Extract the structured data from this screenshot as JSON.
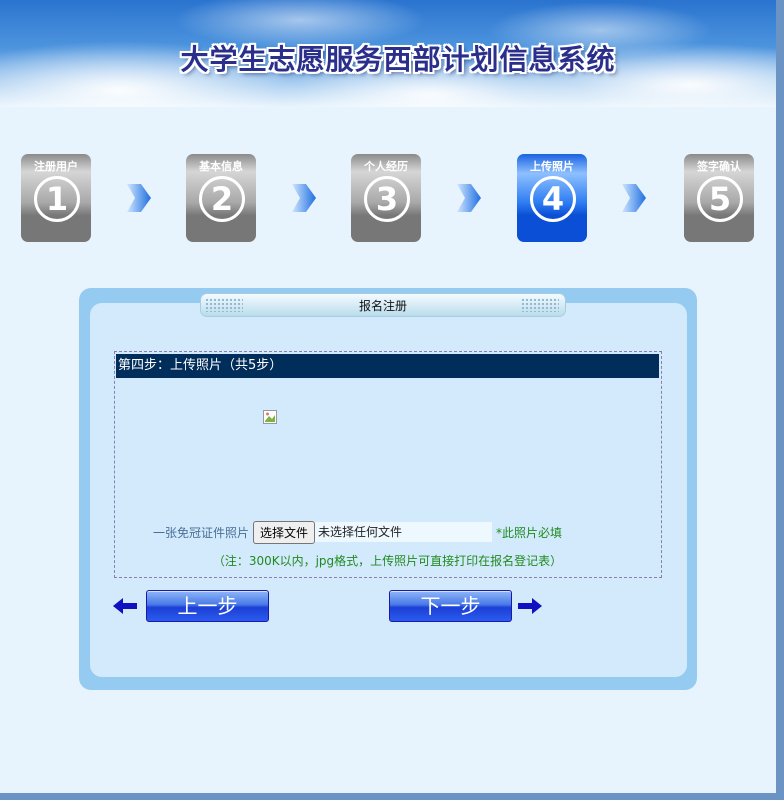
{
  "header": {
    "title": "大学生志愿服务西部计划信息系统"
  },
  "steps": [
    {
      "label": "注册用户",
      "number": "1",
      "active": false
    },
    {
      "label": "基本信息",
      "number": "2",
      "active": false
    },
    {
      "label": "个人经历",
      "number": "3",
      "active": false
    },
    {
      "label": "上传照片",
      "number": "4",
      "active": true
    },
    {
      "label": "签字确认",
      "number": "5",
      "active": false
    }
  ],
  "panel": {
    "title": "报名注册",
    "step_header": "第四步：上传照片（共5步）",
    "photo_label": "一张免冠证件照片",
    "file_button": "选择文件",
    "file_status": "未选择任何文件",
    "required_note": "*此照片必填",
    "hint": "（注：300K以内，jpg格式，上传照片可直接打印在报名登记表）"
  },
  "nav": {
    "prev_label": "上一步",
    "next_label": "下一步"
  },
  "colors": {
    "step_active": "#0a4fd6",
    "header_bar": "#002d5a",
    "button": "#1c3fd6"
  }
}
